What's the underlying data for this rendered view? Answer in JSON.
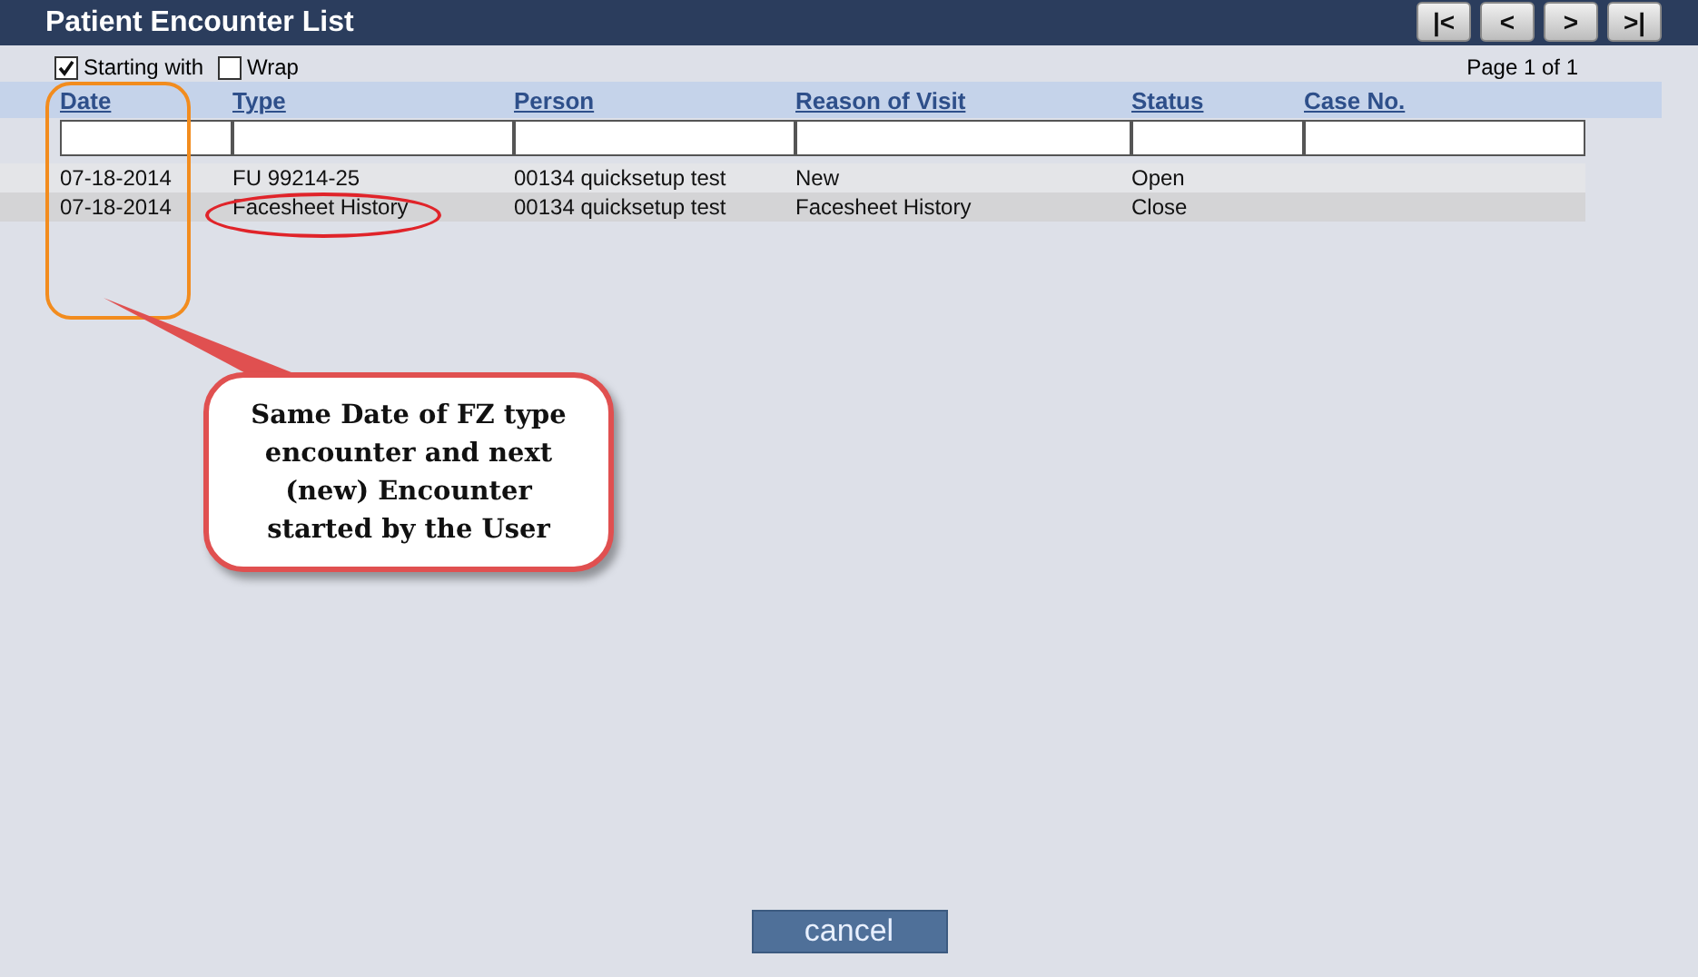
{
  "window": {
    "title": "Patient Encounter List"
  },
  "pager": {
    "buttons": [
      "|<",
      "<",
      ">",
      ">|"
    ],
    "page_label": "Page 1 of 1"
  },
  "options": [
    {
      "label": "Starting with",
      "checked": true
    },
    {
      "label": "Wrap",
      "checked": false
    }
  ],
  "table": {
    "columns": [
      "Date",
      "Type",
      "Person",
      "Reason of Visit",
      "Status",
      "Case No."
    ],
    "rows": [
      {
        "cells": [
          "07-18-2014",
          "FU 99214-25",
          "00134 quicksetup test",
          "New",
          "Open",
          ""
        ],
        "selected": false
      },
      {
        "cells": [
          "07-18-2014",
          "Facesheet History",
          "00134 quicksetup test",
          "Facesheet History",
          "Close",
          ""
        ],
        "selected": true
      }
    ]
  },
  "annotation": {
    "text": "Same Date of FZ type encounter and next (new) Encounter started by the User"
  },
  "buttons": [
    "cancel"
  ]
}
